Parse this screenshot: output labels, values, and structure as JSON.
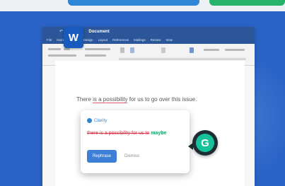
{
  "header": {
    "left_color": "#2e86d6",
    "right_color": "#28b36a"
  },
  "word": {
    "app_icon": "word-logo-icon",
    "brand_color": "#2b579a",
    "title": "Document",
    "quick_access": "↶ ↷ □ ○ ☆",
    "menu": [
      "File",
      "Home",
      "Insert",
      "Design",
      "Layout",
      "References",
      "Mailings",
      "Review",
      "View"
    ]
  },
  "document": {
    "sentence_before": "There ",
    "sentence_flagged": "is a possibility",
    "sentence_after": " for us to go over this issue."
  },
  "grammarly": {
    "brand": "Clarity",
    "suggestion_wrong": "there is a possibility for us to",
    "suggestion_fix": "maybe",
    "primary_button": "Rephrase",
    "dismiss_button": "Dismiss",
    "accent": "#15c39a"
  }
}
